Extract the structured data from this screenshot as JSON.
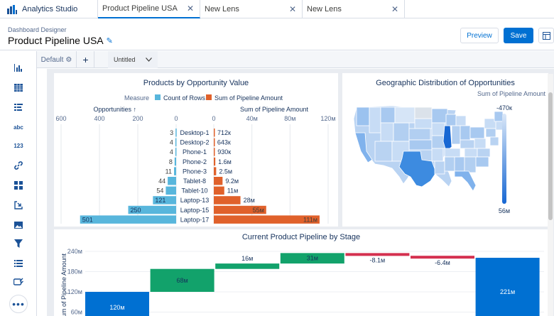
{
  "app": {
    "name": "Analytics Studio"
  },
  "tabs": [
    {
      "label": "Product Pipeline USA",
      "active": true
    },
    {
      "label": "New Lens",
      "active": false
    },
    {
      "label": "New Lens",
      "active": false
    }
  ],
  "header": {
    "breadcrumb": "Dashboard Designer",
    "title": "Product Pipeline USA",
    "preview_label": "Preview",
    "save_label": "Save"
  },
  "pages": {
    "default_label": "Default",
    "add_label": "+",
    "selected_label": "Untitled"
  },
  "left_tools": [
    "bar-chart-icon",
    "table-icon",
    "list-icon",
    "text-icon",
    "number-icon",
    "link-icon",
    "grid-icon",
    "import-icon",
    "image-icon",
    "filter-icon",
    "list-filter-icon",
    "edit-tag-icon"
  ],
  "left_tool_text": {
    "text": "abc",
    "number": "123"
  },
  "colors": {
    "accent": "#0070d2",
    "count": "#58b6dc",
    "sum": "#e0612b",
    "green": "#12a26b",
    "red": "#d4304f"
  },
  "chart_data": [
    {
      "type": "bar",
      "title": "Products by Opportunity Value",
      "legend_title": "Measure",
      "categories": [
        "Desktop-1",
        "Desktop-2",
        "Phone-1",
        "Phone-2",
        "Phone-3",
        "Tablet-8",
        "Tablet-10",
        "Laptop-13",
        "Laptop-15",
        "Laptop-17"
      ],
      "series": [
        {
          "name": "Count of Rows",
          "header": "Opportunities ↑",
          "values": [
            3,
            4,
            4,
            8,
            11,
            44,
            54,
            121,
            250,
            501
          ],
          "labels": [
            "3",
            "4",
            "4",
            "8",
            "11",
            "44",
            "54",
            "121",
            "250",
            "501"
          ],
          "ticks": [
            "600",
            "400",
            "200",
            "0"
          ],
          "xlim": [
            0,
            600
          ]
        },
        {
          "name": "Sum of Pipeline Amount",
          "header": "Sum of Pipeline Amount",
          "values": [
            0.712,
            0.643,
            0.93,
            1.6,
            2.5,
            9.2,
            11,
            28,
            55,
            111
          ],
          "labels": [
            "712к",
            "643к",
            "930к",
            "1.6м",
            "2.5м",
            "9.2м",
            "11м",
            "28м",
            "55м",
            "111м"
          ],
          "ticks": [
            "0",
            "40м",
            "80м",
            "120м"
          ],
          "xlim": [
            0,
            120
          ]
        }
      ]
    },
    {
      "type": "map",
      "title": "Geographic Distribution of Opportunities",
      "legend_title": "Sum of Pipeline Amount",
      "legend_max": "-470к",
      "legend_min": "56м"
    },
    {
      "type": "bar",
      "subtype": "waterfall",
      "title": "Current Product Pipeline by Stage",
      "ylabel": "Sum of Pipeline Amount",
      "yticks": [
        "240м",
        "180м",
        "120м",
        "60м"
      ],
      "ylim": [
        0,
        240
      ],
      "steps": [
        {
          "kind": "total",
          "start": 0,
          "end": 120,
          "label": "120м"
        },
        {
          "kind": "up",
          "start": 120,
          "end": 188,
          "label": "68м"
        },
        {
          "kind": "up",
          "start": 188,
          "end": 204,
          "label": "16м"
        },
        {
          "kind": "up",
          "start": 204,
          "end": 235,
          "label": "31м"
        },
        {
          "kind": "down",
          "start": 235,
          "end": 227,
          "label": "-8.1м"
        },
        {
          "kind": "down",
          "start": 227,
          "end": 221,
          "label": "-6.4м"
        },
        {
          "kind": "total",
          "start": 0,
          "end": 221,
          "label": "221м"
        }
      ]
    }
  ]
}
